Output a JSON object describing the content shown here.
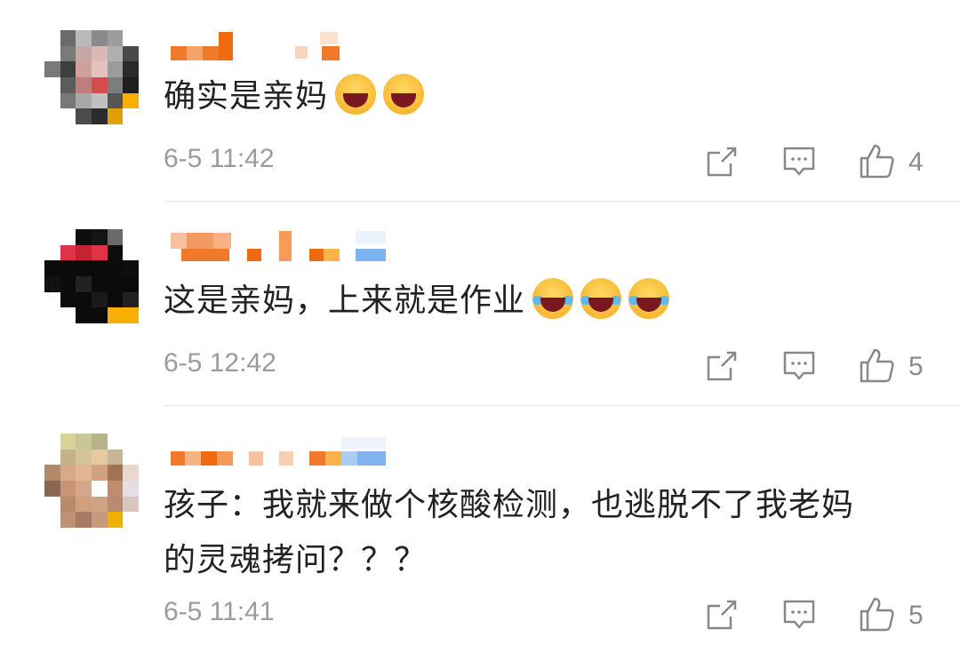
{
  "comments": [
    {
      "text": "确实是亲妈",
      "emojis": [
        "grin-emoji",
        "grin-emoji"
      ],
      "time": "6-5 11:42",
      "likes": "4"
    },
    {
      "text": "这是亲妈，上来就是作业",
      "emojis": [
        "laugh-cry-emoji",
        "laugh-cry-emoji",
        "laugh-cry-emoji"
      ],
      "time": "6-5 12:42",
      "likes": "5"
    },
    {
      "text": "孩子：我就来做个核酸检测，也逃脱不了我老妈\n的灵魂拷问？？？",
      "emojis": [],
      "time": "6-5 11:41",
      "likes": "5"
    }
  ],
  "icons": {
    "share": "share-icon",
    "reply": "reply-icon",
    "like": "thumbs-up-icon"
  },
  "colors": {
    "text": "#222222",
    "meta": "#9b9b9b",
    "icon": "#888888",
    "name_orange": "#f07a2a",
    "name_blue": "#7fb3ee"
  }
}
